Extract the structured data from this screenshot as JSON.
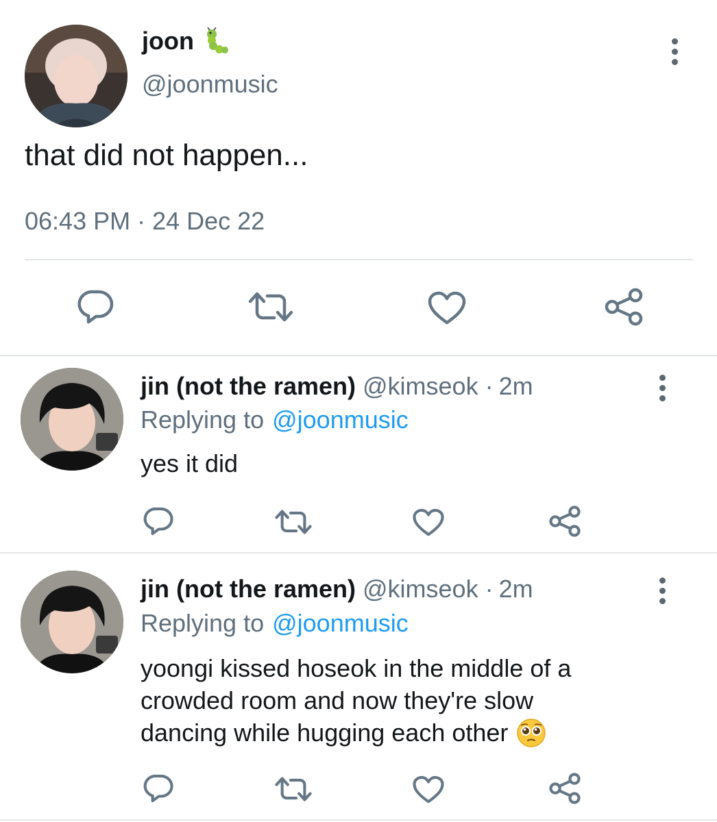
{
  "main_tweet": {
    "display_name": "joon",
    "name_emoji": "🐛",
    "handle": "@joonmusic",
    "text": "that did not happen...",
    "time": "06:43 PM",
    "separator": "·",
    "date": "24 Dec 22"
  },
  "replies": [
    {
      "display_name": "jin (not the ramen)",
      "handle": "@kimseok",
      "sep": "·",
      "age": "2m",
      "replying_prefix": "Replying to",
      "replying_handle": "@joonmusic",
      "text_lines": [
        "yes it did"
      ]
    },
    {
      "display_name": "jin (not the ramen)",
      "handle": "@kimseok",
      "sep": "·",
      "age": "2m",
      "replying_prefix": "Replying to",
      "replying_handle": "@joonmusic",
      "text_lines": [
        "yoongi kissed hoseok in the middle of a",
        "crowded room and now they're slow",
        "dancing while hugging each other"
      ],
      "trailing_emoji": "pleading-face-emoji"
    }
  ],
  "icons": {
    "reply": "reply-icon",
    "retweet": "retweet-icon",
    "like": "heart-icon",
    "share": "share-icon",
    "more": "more-vertical-icon"
  },
  "colors": {
    "text": "#14171a",
    "muted": "#5f6f7d",
    "link": "#1d9bf0",
    "icon": "#657786",
    "divider": "#e3e6e8"
  }
}
